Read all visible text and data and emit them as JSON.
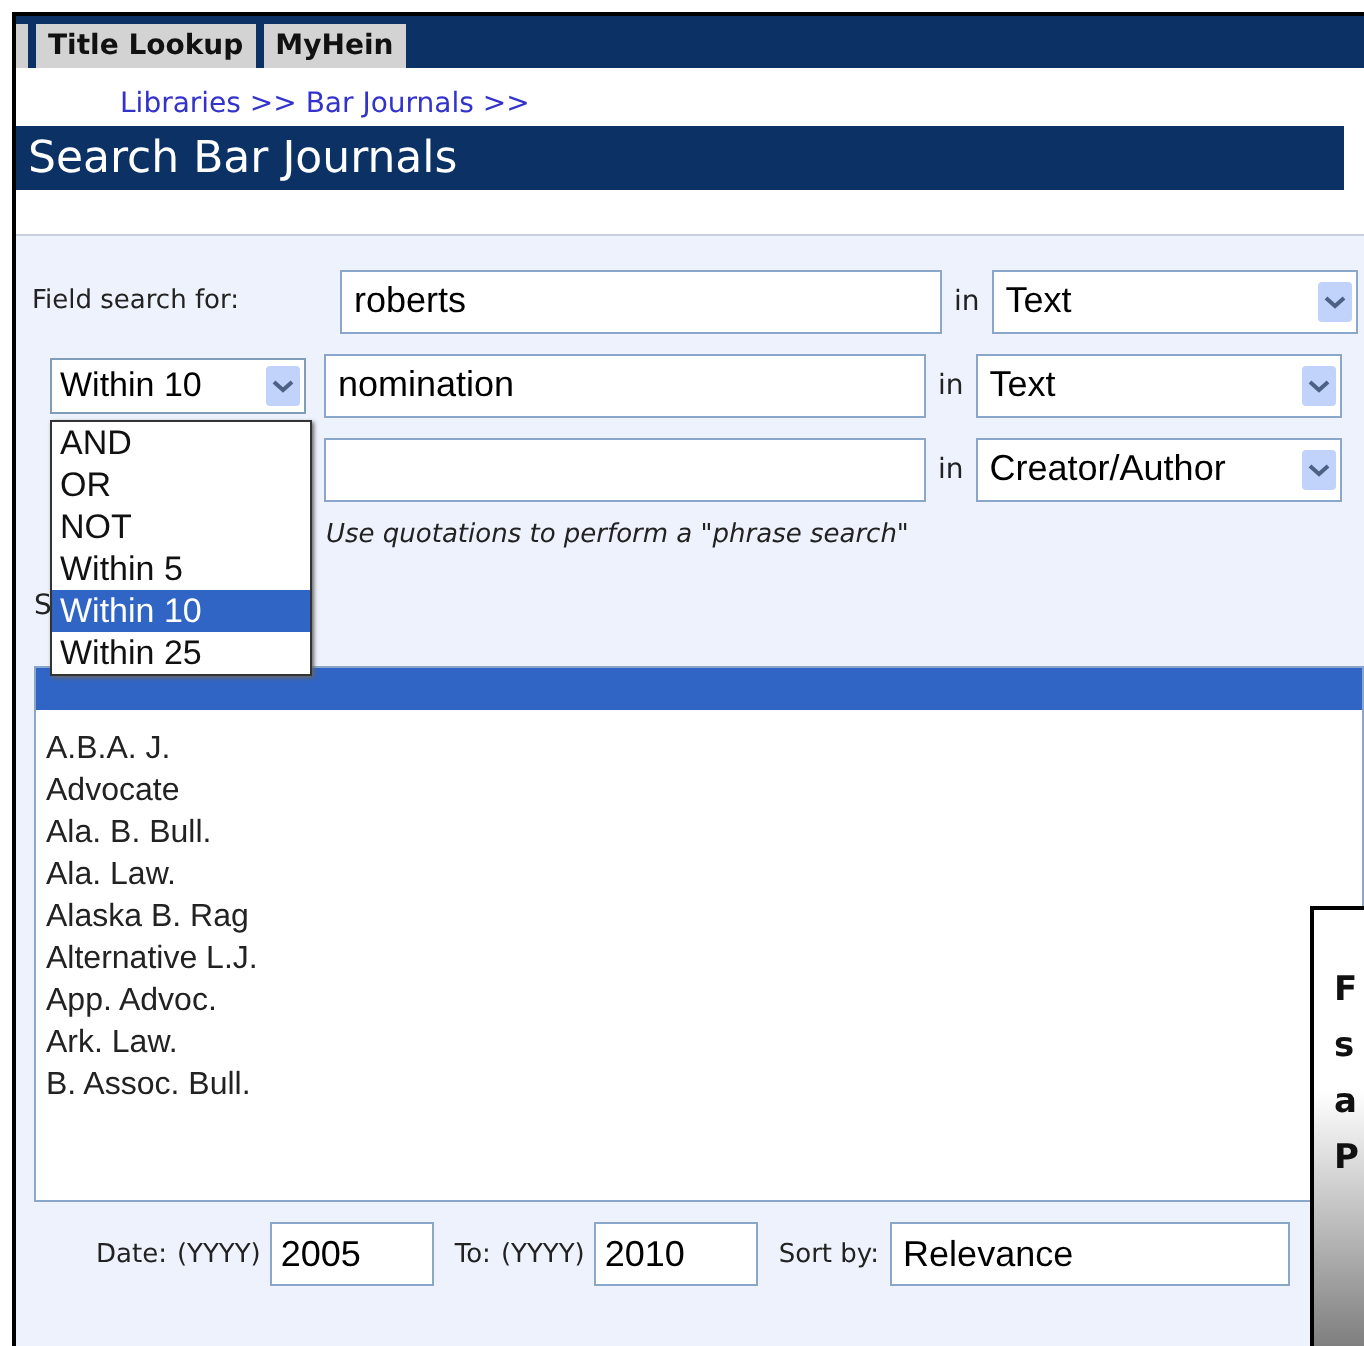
{
  "nav_tabs": [
    {
      "label": "Title Lookup",
      "selected": false
    },
    {
      "label": "MyHein",
      "selected": false
    }
  ],
  "breadcrumb": "Libraries >> Bar Journals >>",
  "page_title": "Search Bar Journals",
  "search_rows": [
    {
      "label": "Field search for:",
      "value": "roberts",
      "in_label": "in",
      "field": "Text"
    },
    {
      "operator": "Within 10",
      "value": "nomination",
      "in_label": "in",
      "field": "Text"
    },
    {
      "value": "",
      "in_label": "in",
      "field": "Creator/Author"
    }
  ],
  "hint": "Use quotations to perform a \"phrase search\"",
  "hidden_label": "S",
  "operator_menu": [
    {
      "label": "AND",
      "selected": false
    },
    {
      "label": "OR",
      "selected": false
    },
    {
      "label": "NOT",
      "selected": false
    },
    {
      "label": "Within 5",
      "selected": false
    },
    {
      "label": "Within 10",
      "selected": true
    },
    {
      "label": "Within 25",
      "selected": false
    }
  ],
  "journals": [
    {
      "selected": true
    },
    {
      "label": "A.B.A. J.",
      "selected": false
    },
    {
      "label": "Advocate",
      "selected": false
    },
    {
      "label": "Ala. B. Bull.",
      "selected": false
    },
    {
      "label": "Ala. Law.",
      "selected": false
    },
    {
      "label": "Alaska B. Rag",
      "selected": false
    },
    {
      "label": "Alternative L.J.",
      "selected": false
    },
    {
      "label": "App. Advoc.",
      "selected": false
    },
    {
      "label": "Ark. Law.",
      "selected": false
    },
    {
      "label": "B. Assoc. Bull.",
      "selected": false
    }
  ],
  "date_from": {
    "label": "Date:",
    "format": "(YYYY)",
    "value": "2005"
  },
  "date_to": {
    "label": "To:",
    "format": "(YYYY)",
    "value": "2010"
  },
  "sort": {
    "label": "Sort by:",
    "value": "Relevance"
  },
  "callout_lines": [
    "F",
    "s",
    "a",
    "P"
  ]
}
